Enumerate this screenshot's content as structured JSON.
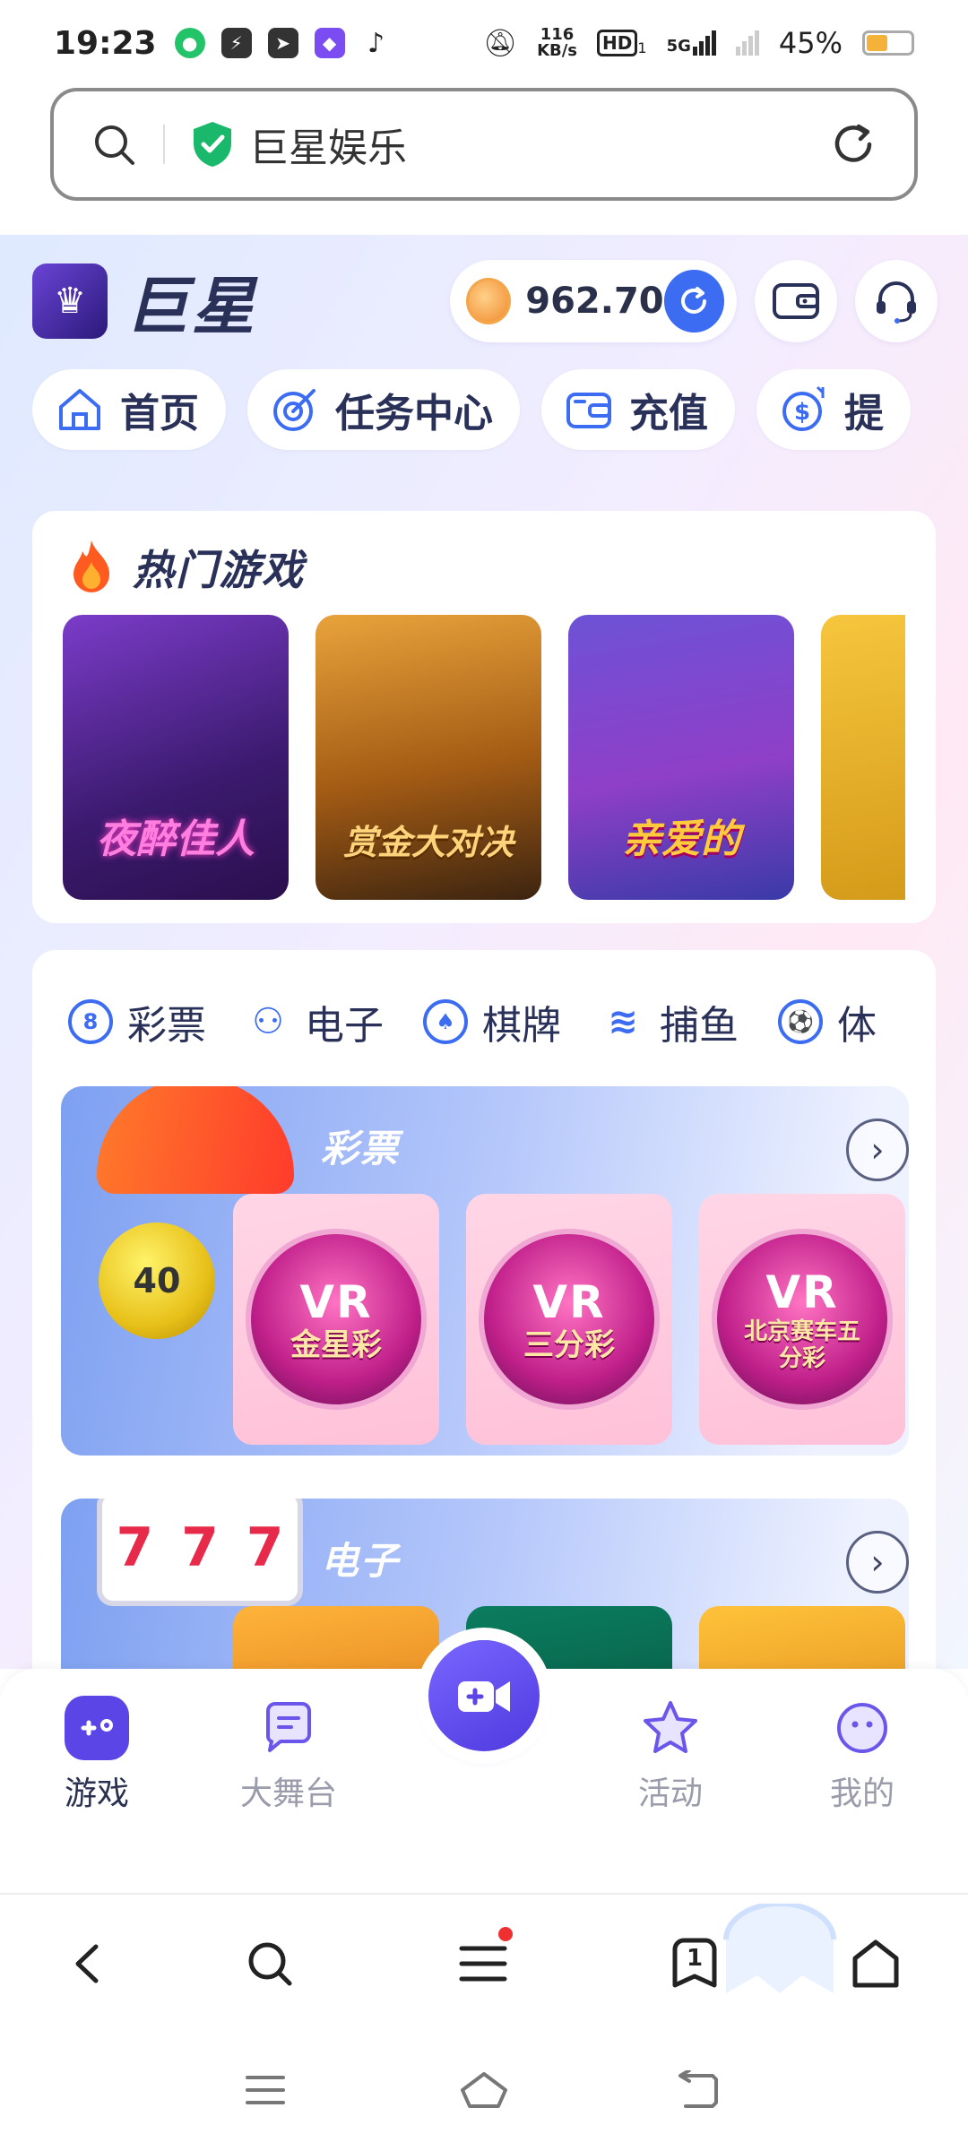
{
  "status_bar": {
    "time": "19:23",
    "net_speed_top": "116",
    "net_speed_unit": "KB/s",
    "hd": "HD",
    "hd_sub": "1",
    "network": "5G",
    "battery": "45%",
    "battery_level": 0.45,
    "app_icons": [
      "pdp-icon",
      "bolt-icon",
      "telegram-icon",
      "vpn-icon",
      "tiktok-icon"
    ]
  },
  "browser": {
    "url_title": "巨星娱乐"
  },
  "header": {
    "brand": "巨星",
    "balance": "962.70"
  },
  "nav_pills": [
    {
      "label": "首页",
      "icon": "home-icon"
    },
    {
      "label": "任务中心",
      "icon": "target-icon"
    },
    {
      "label": "充值",
      "icon": "wallet-icon"
    },
    {
      "label": "提",
      "icon": "dollar-withdraw-icon"
    }
  ],
  "hot_games": {
    "title": "热门游戏",
    "games": [
      {
        "title": "夜醉佳人"
      },
      {
        "title": "赏金大对决"
      },
      {
        "title": "亲爱的"
      },
      {
        "title": ""
      }
    ]
  },
  "categories": {
    "tabs": [
      {
        "label": "彩票",
        "icon_text": "8"
      },
      {
        "label": "电子",
        "icon_text": "⚇"
      },
      {
        "label": "棋牌",
        "icon_text": "♠"
      },
      {
        "label": "捕鱼",
        "icon_text": "≋"
      },
      {
        "label": "体",
        "icon_text": "⚽"
      }
    ],
    "lottery": {
      "title": "彩票",
      "ball_number": "40",
      "tiles": [
        {
          "brand": "VR",
          "name": "金星彩"
        },
        {
          "brand": "VR",
          "name": "三分彩"
        },
        {
          "brand": "VR",
          "name": "北京赛车五分彩"
        }
      ]
    },
    "electronic": {
      "title": "电子",
      "reels": [
        "7",
        "7",
        "7"
      ]
    }
  },
  "tabbar": {
    "tabs": [
      {
        "label": "游戏"
      },
      {
        "label": "大舞台"
      },
      {
        "label": "活动"
      },
      {
        "label": "我的"
      }
    ]
  },
  "browser_nav": {
    "tab_count": "1"
  },
  "colors": {
    "primary": "#3b6cf2",
    "accent_purple": "#5b45e6",
    "text_dark": "#2a3159"
  }
}
